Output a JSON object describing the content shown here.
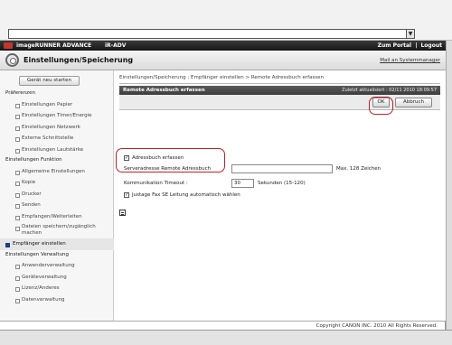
{
  "browser": {
    "address_value": "",
    "dropdown_glyph": "▼"
  },
  "titlebar": {
    "brand": "imageRUNNER ADVANCE",
    "model": "iR-ADV",
    "portal": "Zum Portal",
    "logout": "Logout",
    "separator": "|"
  },
  "header": {
    "title": "Einstellungen/Speicherung",
    "mail": "Mail an Systemmanager"
  },
  "sidebar": {
    "home_button": "Gerät neu starten",
    "sections": [
      {
        "title": "Präferenzen",
        "items": [
          "Einstellungen Papier",
          "Einstellungen Timer/Energie",
          "Einstellungen Netzwerk",
          "Externe Schnittstelle",
          "Einstellungen Lautstärke"
        ]
      },
      {
        "title": "Einstellungen Funktion",
        "items": [
          "Allgemeine Einstellungen",
          "Kopie",
          "Drucker",
          "Senden",
          "Empfangen/Weiterleiten",
          "Dateien speichern/zugänglich machen"
        ]
      },
      {
        "active_item": "Empfänger einstellen"
      },
      {
        "title": "Einstellungen Verwaltung",
        "items": [
          "Anwenderverwaltung",
          "Geräteverwaltung",
          "Lizenz/Anderes",
          "Datenverwaltung"
        ]
      }
    ]
  },
  "content": {
    "breadcrumb": "Einstellungen/Speicherung : Empfänger einstellen > Remote Adressbuch erfassen",
    "panel_title": "Remote Adressbuch erfassen",
    "updated": "Zuletzt aktualisiert : 02/11 2010 18:09:57",
    "ok_label": "OK",
    "cancel_label": "Abbruch",
    "form": {
      "register_label": "Adressbuch erfassen",
      "register_checked": true,
      "server_label": "Serveradresse Remote Adressbuch",
      "server_value": "",
      "server_hint": "Max. 128 Zeichen",
      "timeout_label": "Kommunikation Timeout :",
      "timeout_value": "30",
      "timeout_hint": "Sekunden (15-120)",
      "fax_label": "Justage Fax SE Leitung automatisch wählen",
      "fax_checked": true,
      "check_glyph": "✓"
    }
  },
  "footer": {
    "copyright": "Copyright CANON INC. 2010 All Rights Reserved."
  }
}
